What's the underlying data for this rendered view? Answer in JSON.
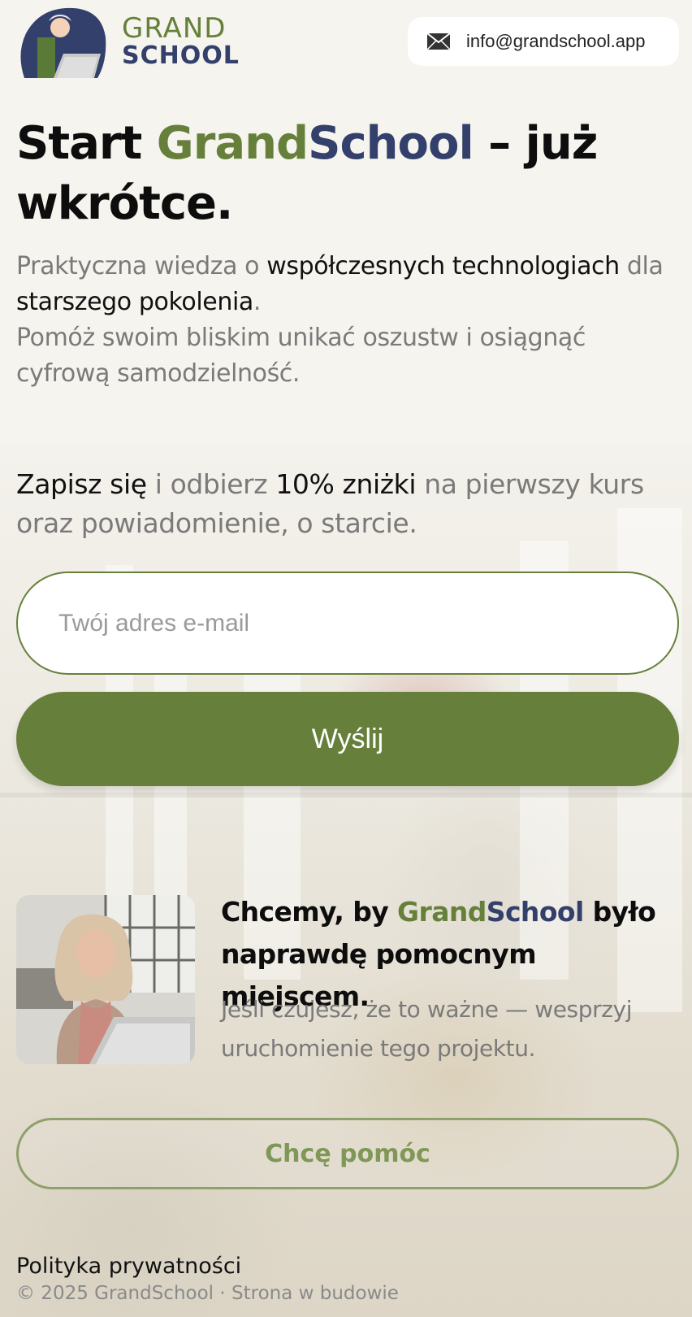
{
  "header": {
    "logo": {
      "line1": "GRAND",
      "line2": "SCHOOL"
    },
    "contact_email": "info@grandschool.app"
  },
  "hero": {
    "title_start": "Start ",
    "title_grand": "Grand",
    "title_school": "School",
    "title_rest": " – już wkrótce.",
    "sub_part1": "Praktyczna wiedza o ",
    "sub_highlight1": "współczesnych technologiach",
    "sub_part2": " dla ",
    "sub_highlight2": "starszego pokolenia",
    "sub_part3": ".",
    "sub_line2": "Pomóż swoim bliskim unikać oszustw i osiągnąć cyfrową samodzielność."
  },
  "signup": {
    "text_dark1": "Zapisz się",
    "text_gray1": " i odbierz ",
    "text_dark2": "10% zniżki",
    "text_gray2": " na pierwszy kurs oraz powiadomienie, o starcie.",
    "email_placeholder": "Twój adres e-mail",
    "submit_label": "Wyślij"
  },
  "support": {
    "title_part1": "Chcemy, by ",
    "title_grand": "Grand",
    "title_school": "School",
    "title_part2": " było naprawdę pomocnym miejscem.",
    "text": "Jeśli czujesz, że to ważne — wesprzyj uruchomienie tego projektu.",
    "button_label": "Chcę pomóc"
  },
  "footer": {
    "privacy_link": "Polityka prywatności",
    "copyright": "© 2025 GrandSchool · Strona w budowie"
  },
  "colors": {
    "brand_green": "#66803c",
    "brand_navy": "#33406b",
    "background": "#f6f4ee"
  },
  "icons": {
    "contact": "envelope-icon"
  }
}
